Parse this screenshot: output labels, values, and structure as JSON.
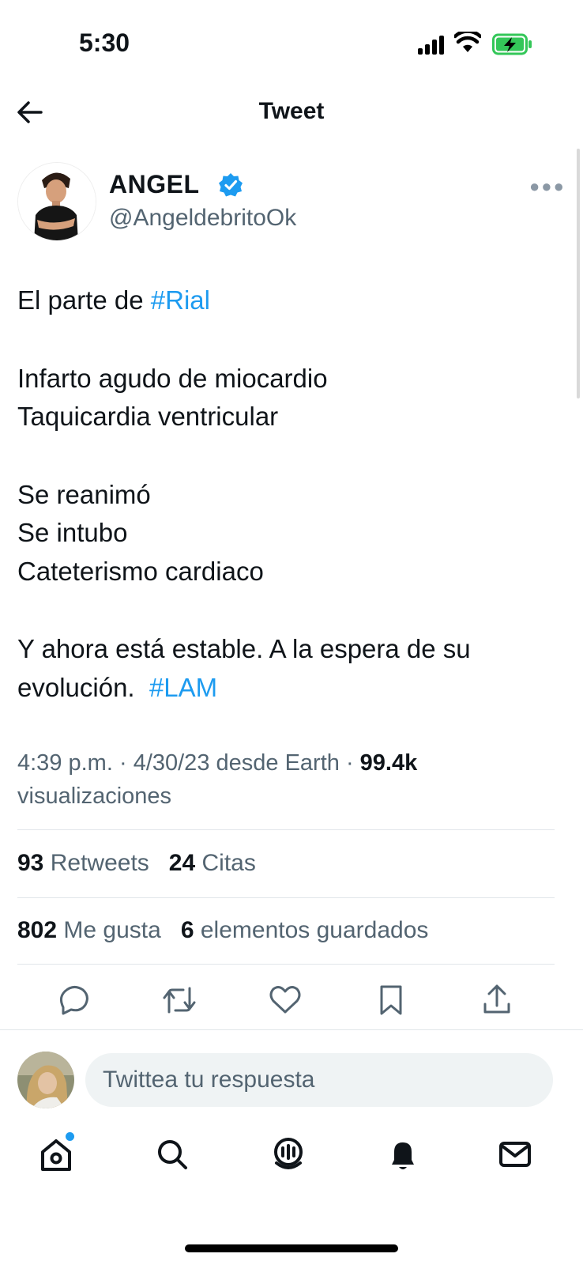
{
  "status_bar": {
    "time": "5:30"
  },
  "header": {
    "title": "Tweet"
  },
  "author": {
    "name": "ANGEL",
    "handle": "@AngeldebritoOk"
  },
  "tweet": {
    "lines": [
      {
        "text": "El parte de ",
        "hashtag": "#Rial"
      },
      {
        "text": ""
      },
      {
        "text": "Infarto agudo de miocardio"
      },
      {
        "text": "Taquicardia ventricular"
      },
      {
        "text": ""
      },
      {
        "text": "Se reanimó"
      },
      {
        "text": "Se intubo"
      },
      {
        "text": "Cateterismo cardiaco"
      },
      {
        "text": ""
      },
      {
        "text": "Y ahora está estable. A la espera de su"
      },
      {
        "text": "evolución.  ",
        "hashtag": "#LAM"
      }
    ]
  },
  "meta": {
    "time": "4:39 p.m.",
    "separator": " · ",
    "date_source": "4/30/23 desde Earth",
    "views_count": "99.4k",
    "views_label": "visualizaciones"
  },
  "stats": {
    "retweets_count": "93",
    "retweets_label": "Retweets",
    "quotes_count": "24",
    "quotes_label": "Citas",
    "likes_count": "802",
    "likes_label": "Me gusta",
    "bookmarks_count": "6",
    "bookmarks_label": "elementos guardados"
  },
  "reply": {
    "placeholder": "Twittea tu respuesta"
  },
  "icons": {
    "back": "arrow-left-icon",
    "verified": "verified-badge-icon",
    "more": "more-icon",
    "reply": "comment-icon",
    "retweet": "retweet-icon",
    "like": "heart-icon",
    "bookmark": "bookmark-icon",
    "share": "share-icon",
    "home": "home-icon",
    "search": "search-icon",
    "spaces": "spaces-icon",
    "notifications": "bell-icon",
    "messages": "mail-icon"
  },
  "colors": {
    "accent": "#1d9bf0",
    "text": "#0f1419",
    "secondary_text": "#536471",
    "battery_charging": "#34c759"
  }
}
